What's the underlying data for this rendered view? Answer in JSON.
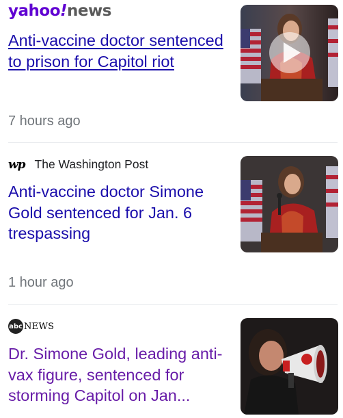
{
  "articles": [
    {
      "source": {
        "brand": "yahoo",
        "bang": "!",
        "suffix": "news"
      },
      "headline": "Anti-vaccine doctor sentenced to prison for Capitol riot",
      "time": "7 hours ago",
      "thumbnail": {
        "has_play_button": true,
        "play_icon": "play-icon"
      }
    },
    {
      "source": {
        "logo": "wp",
        "name": "The Washington Post"
      },
      "headline": "Anti-vaccine doctor Simone Gold sentenced for Jan. 6 trespassing",
      "time": "1 hour ago",
      "thumbnail": {
        "has_play_button": false
      }
    },
    {
      "source": {
        "logo": "abc",
        "name": "NEWS"
      },
      "headline": "Dr. Simone Gold, leading anti-vax figure, sentenced for storming Capitol on Jan...",
      "thumbnail": {
        "has_play_button": false
      }
    }
  ],
  "colors": {
    "link": "#1a0dab",
    "visited": "#681da8",
    "meta": "#70757a",
    "yahoo_purple": "#6001d2",
    "divider": "#e8eaed"
  }
}
